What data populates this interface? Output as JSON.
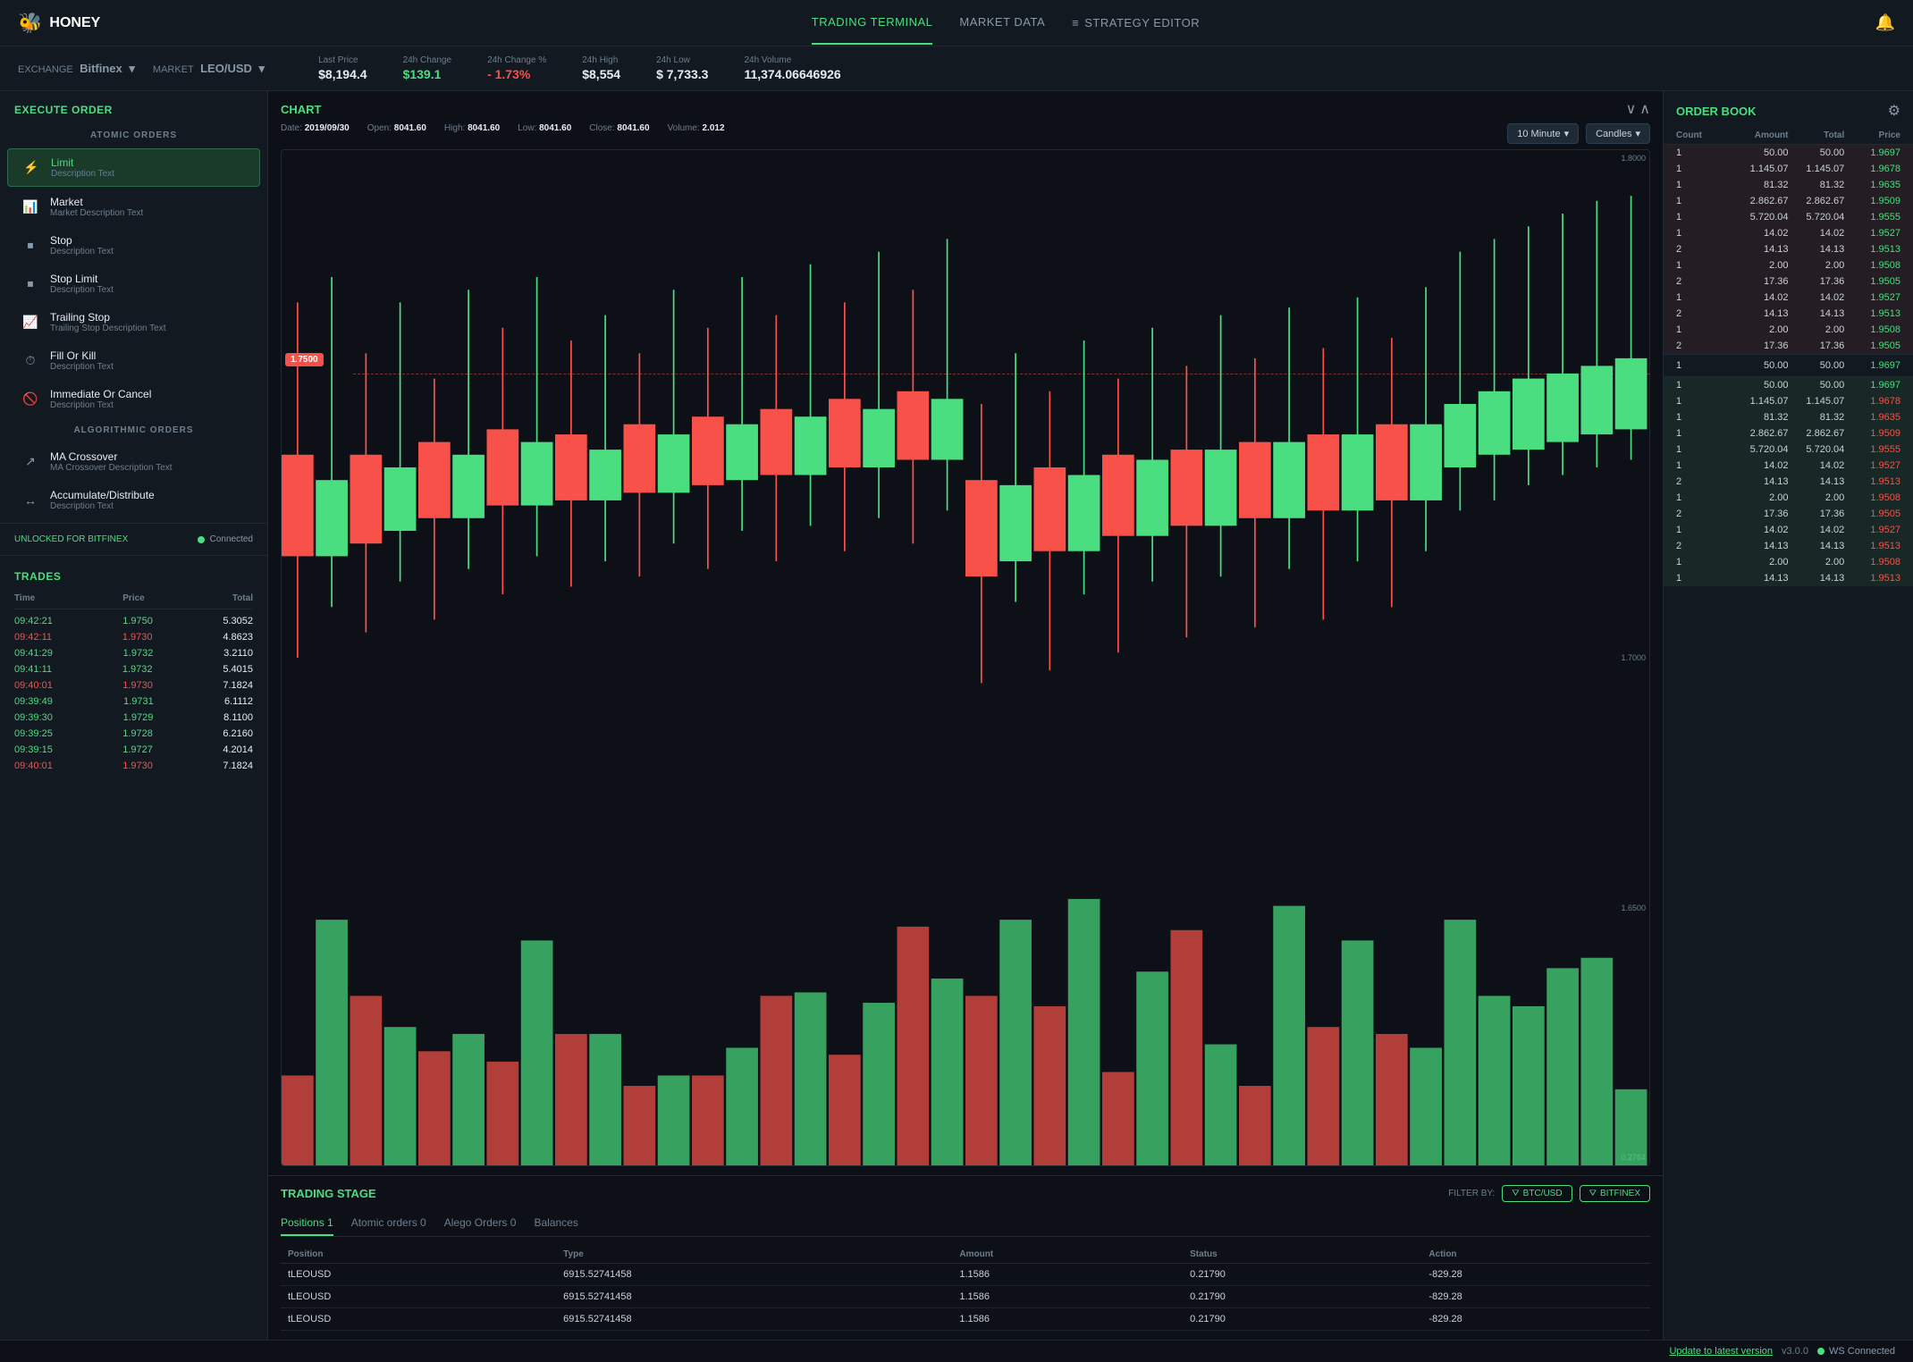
{
  "app": {
    "name": "HONEY",
    "logo_icon": "🐝"
  },
  "nav": {
    "links": [
      {
        "id": "trading",
        "label": "TRADING TERMINAL",
        "active": true
      },
      {
        "id": "market",
        "label": "MARKET DATA",
        "active": false
      },
      {
        "id": "strategy",
        "label": "STRATEGY EDITOR",
        "active": false
      }
    ]
  },
  "marketbar": {
    "exchange_label": "EXCHANGE",
    "exchange_value": "Bitfinex",
    "market_label": "MARKET",
    "market_value": "LEO/USD",
    "stats": [
      {
        "label": "Last Price",
        "value": "$8,194.4",
        "color": "normal"
      },
      {
        "label": "24h Change",
        "value": "$139.1",
        "color": "green"
      },
      {
        "label": "24h Change %",
        "value": "- 1.73%",
        "color": "red"
      },
      {
        "label": "24h High",
        "value": "$8,554",
        "color": "normal"
      },
      {
        "label": "24h Low",
        "value": "$ 7,733.3",
        "color": "normal"
      },
      {
        "label": "24h Volume",
        "value": "11,374.06646926",
        "color": "normal"
      }
    ]
  },
  "left": {
    "execute_order_title": "EXECUTE ORDER",
    "atomic_orders_title": "ATOMIC ORDERS",
    "orders": [
      {
        "id": "limit",
        "name": "Limit",
        "desc": "Description Text",
        "active": true,
        "icon": "⚡"
      },
      {
        "id": "market",
        "name": "Market",
        "desc": "Market Description Text",
        "active": false,
        "icon": "📊"
      },
      {
        "id": "stop",
        "name": "Stop",
        "desc": "Description Text",
        "active": false,
        "icon": "⏹"
      },
      {
        "id": "stop-limit",
        "name": "Stop Limit",
        "desc": "Description Text",
        "active": false,
        "icon": "⏹"
      },
      {
        "id": "trailing-stop",
        "name": "Trailing Stop",
        "desc": "Trailing Stop Description Text",
        "active": false,
        "icon": "📈"
      },
      {
        "id": "fill-or-kill",
        "name": "Fill Or Kill",
        "desc": "Description Text",
        "active": false,
        "icon": "⏱"
      },
      {
        "id": "immediate-or-cancel",
        "name": "Immediate Or Cancel",
        "desc": "Description Text",
        "active": false,
        "icon": "🚫"
      }
    ],
    "algo_orders_title": "ALGORITHMIC ORDERS",
    "algo_orders": [
      {
        "id": "ma-crossover",
        "name": "MA Crossover",
        "desc": "MA Crossover Description Text",
        "icon": "↗"
      },
      {
        "id": "accumulate",
        "name": "Accumulate/Distribute",
        "desc": "Description Text",
        "icon": "↔"
      }
    ],
    "unlocked_label": "UNLOCKED FOR BITFINEX",
    "connected_label": "Connected",
    "trades_title": "TRADES",
    "trades_headers": [
      "Time",
      "Price",
      "Total"
    ],
    "trades": [
      {
        "time": "09:42:21",
        "price": "1.9750",
        "total": "5.3052",
        "color": "green"
      },
      {
        "time": "09:42:11",
        "price": "1.9730",
        "total": "4.8623",
        "color": "red"
      },
      {
        "time": "09:41:29",
        "price": "1.9732",
        "total": "3.2110",
        "color": "green"
      },
      {
        "time": "09:41:11",
        "price": "1.9732",
        "total": "5.4015",
        "color": "green"
      },
      {
        "time": "09:40:01",
        "price": "1.9730",
        "total": "7.1824",
        "color": "red"
      },
      {
        "time": "09:39:49",
        "price": "1.9731",
        "total": "6.1112",
        "color": "green"
      },
      {
        "time": "09:39:30",
        "price": "1.9729",
        "total": "8.1100",
        "color": "green"
      },
      {
        "time": "09:39:25",
        "price": "1.9728",
        "total": "6.2160",
        "color": "green"
      },
      {
        "time": "09:39:15",
        "price": "1.9727",
        "total": "4.2014",
        "color": "green"
      },
      {
        "time": "09:40:01",
        "price": "1.9730",
        "total": "7.1824",
        "color": "red"
      }
    ]
  },
  "chart": {
    "title": "CHART",
    "ohlc": {
      "date_label": "Date:",
      "date_value": "2019/09/30",
      "open_label": "Open:",
      "open_value": "8041.60",
      "high_label": "High:",
      "high_value": "8041.60",
      "low_label": "Low:",
      "low_value": "8041.60",
      "close_label": "Close:",
      "close_value": "8041.60",
      "volume_label": "Volume:",
      "volume_value": "2.012"
    },
    "interval_label": "10 Minute",
    "type_label": "Candles",
    "price_label": "1.7500",
    "y_labels": [
      "1.8000",
      "1.7500",
      "1.7000",
      "1.6500"
    ]
  },
  "trading_stage": {
    "title": "TRADING STAGE",
    "filter_label": "FILTER BY:",
    "filter_btc": "BTC/USD",
    "filter_bitfinex": "BITFINEX",
    "tabs": [
      {
        "id": "positions",
        "label": "Positions 1",
        "active": true
      },
      {
        "id": "atomic",
        "label": "Atomic orders 0",
        "active": false
      },
      {
        "id": "alego",
        "label": "Alego Orders 0",
        "active": false
      },
      {
        "id": "balances",
        "label": "Balances",
        "active": false
      }
    ],
    "positions_headers": [
      "Position",
      "Type",
      "Amount",
      "Status",
      "Action"
    ],
    "positions": [
      {
        "position": "tLEOUSD",
        "type": "6915.52741458",
        "amount": "1.1586",
        "status": "0.21790",
        "action": "-829.28"
      },
      {
        "position": "tLEOUSD",
        "type": "6915.52741458",
        "amount": "1.1586",
        "status": "0.21790",
        "action": "-829.28"
      },
      {
        "position": "tLEOUSD",
        "type": "6915.52741458",
        "amount": "1.1586",
        "status": "0.21790",
        "action": "-829.28"
      }
    ]
  },
  "orderbook": {
    "title": "ORDER BOOK",
    "cols": [
      "Count",
      "Amount",
      "Total",
      "Price"
    ],
    "asks": [
      {
        "count": "1",
        "amount": "50.00",
        "total": "50.00",
        "price": "1.9697"
      },
      {
        "count": "1",
        "amount": "1.145.07",
        "total": "1.145.07",
        "price": "1.9678"
      },
      {
        "count": "1",
        "amount": "81.32",
        "total": "81.32",
        "price": "1.9635"
      },
      {
        "count": "1",
        "amount": "2.862.67",
        "total": "2.862.67",
        "price": "1.9509"
      },
      {
        "count": "1",
        "amount": "5.720.04",
        "total": "5.720.04",
        "price": "1.9555"
      },
      {
        "count": "1",
        "amount": "14.02",
        "total": "14.02",
        "price": "1.9527"
      },
      {
        "count": "2",
        "amount": "14.13",
        "total": "14.13",
        "price": "1.9513"
      },
      {
        "count": "1",
        "amount": "2.00",
        "total": "2.00",
        "price": "1.9508"
      },
      {
        "count": "2",
        "amount": "17.36",
        "total": "17.36",
        "price": "1.9505"
      },
      {
        "count": "1",
        "amount": "14.02",
        "total": "14.02",
        "price": "1.9527"
      },
      {
        "count": "2",
        "amount": "14.13",
        "total": "14.13",
        "price": "1.9513"
      },
      {
        "count": "1",
        "amount": "2.00",
        "total": "2.00",
        "price": "1.9508"
      },
      {
        "count": "2",
        "amount": "17.36",
        "total": "17.36",
        "price": "1.9505"
      }
    ],
    "mid": {
      "count": "1",
      "amount": "50.00",
      "total": "50.00",
      "price": "1.9697"
    },
    "bids": [
      {
        "count": "1",
        "amount": "50.00",
        "total": "50.00",
        "price": "1.9697"
      },
      {
        "count": "1",
        "amount": "1.145.07",
        "total": "1.145.07",
        "price": "1.9678"
      },
      {
        "count": "1",
        "amount": "81.32",
        "total": "81.32",
        "price": "1.9635"
      },
      {
        "count": "1",
        "amount": "2.862.67",
        "total": "2.862.67",
        "price": "1.9509"
      },
      {
        "count": "1",
        "amount": "5.720.04",
        "total": "5.720.04",
        "price": "1.9555"
      },
      {
        "count": "1",
        "amount": "14.02",
        "total": "14.02",
        "price": "1.9527"
      },
      {
        "count": "2",
        "amount": "14.13",
        "total": "14.13",
        "price": "1.9513"
      },
      {
        "count": "1",
        "amount": "2.00",
        "total": "2.00",
        "price": "1.9508"
      },
      {
        "count": "2",
        "amount": "17.36",
        "total": "17.36",
        "price": "1.9505"
      },
      {
        "count": "1",
        "amount": "14.02",
        "total": "14.02",
        "price": "1.9527"
      },
      {
        "count": "2",
        "amount": "14.13",
        "total": "14.13",
        "price": "1.9513"
      },
      {
        "count": "1",
        "amount": "2.00",
        "total": "2.00",
        "price": "1.9508"
      },
      {
        "count": "1",
        "amount": "14.13",
        "total": "14.13",
        "price": "1.9513"
      }
    ]
  },
  "footer": {
    "update_label": "Update to latest version",
    "version": "v3.0.0",
    "ws_label": "WS Connected"
  }
}
